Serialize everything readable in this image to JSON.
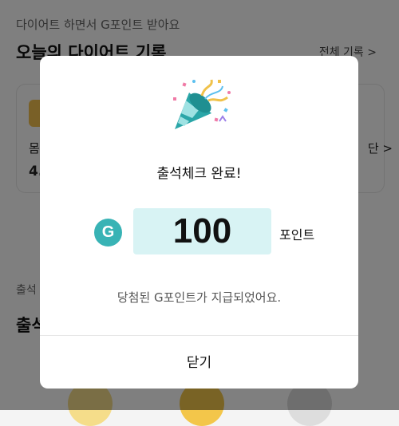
{
  "background": {
    "section1_subtitle": "다이어트 하면서 G포인트 받아요",
    "section1_title": "오늘의 다이어트 기록",
    "view_all": "전체 기록 >",
    "card_label_left": "몸",
    "card_value_left": "4.",
    "card_label_right": "단 >",
    "section2_subtitle": "출석",
    "section2_title": "출석"
  },
  "modal": {
    "icon": "party-popper-icon",
    "title": "출석체크 완료!",
    "point_badge": "G",
    "amount": "100",
    "unit": "포인트",
    "message": "당첨된 G포인트가 지급되었어요.",
    "close_label": "닫기"
  },
  "colors": {
    "accent": "#38b3b5",
    "amount_bg": "#d8f3f4",
    "overlay": "rgba(0,0,0,0.5)"
  }
}
